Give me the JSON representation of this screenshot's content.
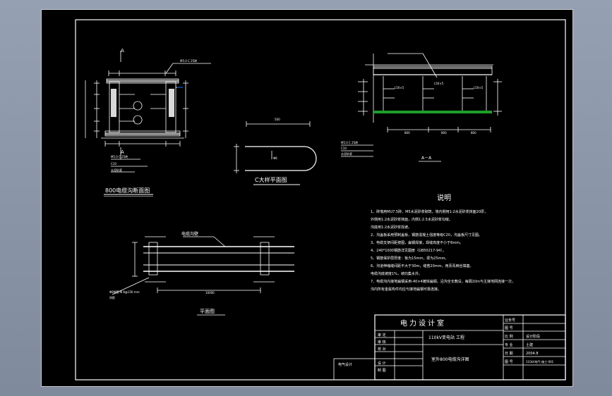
{
  "drawing": {
    "section_title": "800电缆沟断面图",
    "bend_title": "C大样平面图",
    "plan_title": "平面图",
    "aa_title": "A－A",
    "trench_label": "电缆沟壁",
    "section_mark": "A",
    "small_labels": {
      "brick": "M5.0 C 25砖",
      "c10": "C10",
      "sand": "水泥砂浆"
    }
  },
  "notes": {
    "title": "说明",
    "items": [
      "1、砖墙用MU7.5砖、M5水泥砂浆砌筑，墙内侧用1:2水泥砂浆抹面20厚，",
      "   外侧用1:2水泥砂浆抹面，内侧1:2.5水泥砂浆勾缝。",
      "   沟底用1:2水泥砂浆找坡。",
      "2、沟盖板采用预制盖板，钢筋混凝土强度等级C20，沟盖板尺寸见图。",
      "3、电缆支架间距按图，扁钢焊接，焊缝高度不小于6mm。",
      "4、240*1000钢筋详见图册（GB50217-94）。",
      "5、钢筋保护层厚度：板为15mm，梁为25mm。",
      "6、沟道伸缩缝间距不大于30m，缝宽20mm，用沥青麻丝填塞。",
      "   电缆沟底坡度1%，坡向集水井。",
      "7、电缆沟内接地扁钢采用-40×4镀锌扁钢，沿沟全长敷设，每隔10m与主接地网连接一次，",
      "   沟内所有金属构件均应与接地扁钢可靠连接。"
    ]
  },
  "title_block": {
    "company": "电力设计室",
    "project": "110kV变电站 工程",
    "drawing_name": "室外800电缆沟详图",
    "stamp": "电气设计",
    "left_rows": [
      "审 定",
      "审 核",
      "校 对",
      "设 计",
      "制 图"
    ],
    "right_labels": [
      "业务号",
      "图 号",
      "比 例",
      "专 业",
      "日 期",
      "图 号"
    ],
    "right_values": [
      "",
      "",
      "设计阶段",
      "土建",
      "2004.8",
      "110kV电气-施工-001"
    ]
  },
  "colors": {
    "background": "#000000",
    "line": "#ffffff",
    "grass": "#1e9e2a",
    "frame_outer": "#c9c9c9",
    "viewport": "#8b96a8"
  }
}
